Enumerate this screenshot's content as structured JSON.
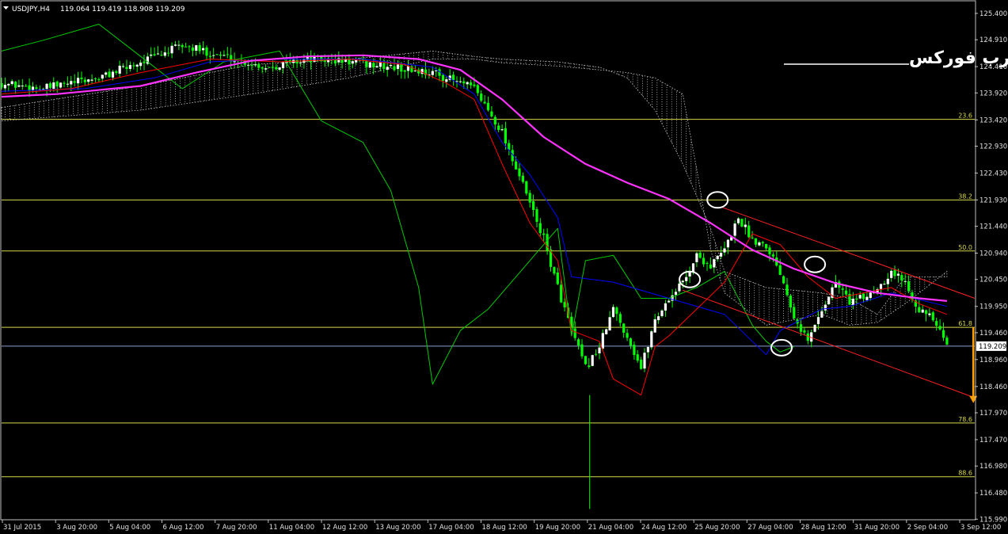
{
  "header": {
    "symbol": "USDJPY,H4",
    "ohlc": "119.064 119.419 118.908 119.209"
  },
  "brand": {
    "text": "عرب فوركس",
    "color": "#ffffff"
  },
  "colors": {
    "background": "#000000",
    "frame": "#c0c0c0",
    "bull_candle": "#ffffff",
    "bear_candle": "#00ff00",
    "ma_slow": "#ff33ff",
    "tenkan": "#ff0000",
    "kijun": "#0000ff",
    "chikou": "#00cc00",
    "cloud": "#c8c8c8",
    "fib_line": "#d8d84a",
    "bid_line": "#8ea0d0",
    "trend_line": "#ff2020",
    "arrow": "#ffa000",
    "annotation": "#ffffff"
  },
  "chart_data": {
    "type": "candlestick",
    "symbol": "USDJPY",
    "timeframe": "H4",
    "y_range": [
      115.98,
      125.62
    ],
    "y_ticks": [
      "125.400",
      "124.910",
      "124.410",
      "123.920",
      "123.420",
      "122.930",
      "122.430",
      "121.930",
      "121.440",
      "120.940",
      "120.450",
      "119.950",
      "119.460",
      "118.960",
      "118.460",
      "117.970",
      "117.470",
      "116.980",
      "116.480",
      "115.990"
    ],
    "x_ticks": [
      "31 Jul 2015",
      "3 Aug 20:00",
      "5 Aug 04:00",
      "6 Aug 12:00",
      "7 Aug 20:00",
      "11 Aug 04:00",
      "12 Aug 12:00",
      "13 Aug 20:00",
      "17 Aug 04:00",
      "18 Aug 12:00",
      "19 Aug 20:00",
      "21 Aug 04:00",
      "24 Aug 12:00",
      "25 Aug 20:00",
      "27 Aug 04:00",
      "28 Aug 12:00",
      "31 Aug 20:00",
      "2 Sep 04:00",
      "3 Sep 12:00"
    ],
    "current_price": "119.209",
    "fibonacci_levels": [
      {
        "label": "23.6",
        "price": 123.43
      },
      {
        "label": "38.2",
        "price": 121.93
      },
      {
        "label": "50.0",
        "price": 120.98
      },
      {
        "label": "61.8",
        "price": 119.56
      },
      {
        "label": "78.6",
        "price": 117.78
      },
      {
        "label": "88.6",
        "price": 116.78
      }
    ],
    "price_path": [
      [
        0,
        124.1
      ],
      [
        6,
        124.0
      ],
      [
        14,
        124.2
      ],
      [
        20,
        124.5
      ],
      [
        26,
        124.8
      ],
      [
        32,
        124.6
      ],
      [
        38,
        124.4
      ],
      [
        44,
        124.55
      ],
      [
        50,
        124.5
      ],
      [
        56,
        124.4
      ],
      [
        62,
        124.3
      ],
      [
        68,
        124.0
      ],
      [
        72,
        123.2
      ],
      [
        75,
        122.2
      ],
      [
        78,
        121.2
      ],
      [
        80,
        120.3
      ],
      [
        82,
        119.5
      ],
      [
        84,
        118.8
      ],
      [
        86,
        119.2
      ],
      [
        88,
        119.9
      ],
      [
        90,
        119.4
      ],
      [
        92,
        118.8
      ],
      [
        94,
        119.7
      ],
      [
        96,
        120.1
      ],
      [
        98,
        120.4
      ],
      [
        100,
        120.9
      ],
      [
        102,
        120.7
      ],
      [
        104,
        121.0
      ],
      [
        106,
        121.6
      ],
      [
        108,
        121.2
      ],
      [
        110,
        121.1
      ],
      [
        112,
        120.6
      ],
      [
        114,
        119.8
      ],
      [
        116,
        119.3
      ],
      [
        118,
        119.9
      ],
      [
        120,
        120.4
      ],
      [
        122,
        120.05
      ],
      [
        124,
        120.1
      ],
      [
        126,
        120.3
      ],
      [
        128,
        120.6
      ],
      [
        130,
        120.4
      ],
      [
        132,
        119.9
      ],
      [
        134,
        119.7
      ],
      [
        136,
        119.2
      ]
    ],
    "ma_slow": [
      [
        0,
        123.85
      ],
      [
        8,
        123.9
      ],
      [
        20,
        124.05
      ],
      [
        28,
        124.3
      ],
      [
        36,
        124.52
      ],
      [
        44,
        124.6
      ],
      [
        52,
        124.62
      ],
      [
        60,
        124.55
      ],
      [
        66,
        124.35
      ],
      [
        72,
        123.8
      ],
      [
        78,
        123.1
      ],
      [
        84,
        122.6
      ],
      [
        90,
        122.25
      ],
      [
        96,
        121.95
      ],
      [
        102,
        121.5
      ],
      [
        108,
        121.0
      ],
      [
        114,
        120.65
      ],
      [
        120,
        120.38
      ],
      [
        126,
        120.2
      ],
      [
        132,
        120.1
      ],
      [
        136,
        120.05
      ]
    ],
    "tenkan": [
      [
        0,
        123.9
      ],
      [
        10,
        124.0
      ],
      [
        20,
        124.3
      ],
      [
        30,
        124.55
      ],
      [
        40,
        124.5
      ],
      [
        50,
        124.55
      ],
      [
        58,
        124.45
      ],
      [
        64,
        124.1
      ],
      [
        68,
        123.8
      ],
      [
        72,
        122.6
      ],
      [
        76,
        121.5
      ],
      [
        80,
        120.8
      ],
      [
        82,
        119.5
      ],
      [
        86,
        119.3
      ],
      [
        88,
        118.6
      ],
      [
        92,
        118.3
      ],
      [
        94,
        119.2
      ],
      [
        96,
        119.4
      ],
      [
        100,
        119.9
      ],
      [
        104,
        120.4
      ],
      [
        108,
        121.3
      ],
      [
        112,
        121.1
      ],
      [
        116,
        120.5
      ],
      [
        120,
        120.1
      ],
      [
        124,
        120.2
      ],
      [
        128,
        120.3
      ],
      [
        132,
        120.0
      ],
      [
        136,
        119.8
      ]
    ],
    "kijun": [
      [
        0,
        123.95
      ],
      [
        12,
        124.0
      ],
      [
        22,
        124.2
      ],
      [
        30,
        124.5
      ],
      [
        40,
        124.55
      ],
      [
        52,
        124.55
      ],
      [
        62,
        124.4
      ],
      [
        68,
        123.9
      ],
      [
        72,
        123.0
      ],
      [
        76,
        122.4
      ],
      [
        80,
        121.6
      ],
      [
        82,
        120.5
      ],
      [
        88,
        120.4
      ],
      [
        96,
        120.1
      ],
      [
        104,
        119.8
      ],
      [
        108,
        119.3
      ],
      [
        110,
        119.05
      ],
      [
        112,
        119.5
      ],
      [
        118,
        119.9
      ],
      [
        122,
        119.95
      ],
      [
        128,
        120.2
      ],
      [
        136,
        119.95
      ]
    ],
    "chikou": [
      [
        0,
        124.7
      ],
      [
        6,
        124.9
      ],
      [
        14,
        125.2
      ],
      [
        20,
        124.6
      ],
      [
        26,
        124.0
      ],
      [
        32,
        124.5
      ],
      [
        40,
        124.7
      ],
      [
        46,
        123.4
      ],
      [
        52,
        123.0
      ],
      [
        56,
        122.1
      ],
      [
        60,
        120.3
      ],
      [
        62,
        118.5
      ],
      [
        66,
        119.5
      ],
      [
        70,
        119.9
      ],
      [
        74,
        120.5
      ],
      [
        78,
        121.1
      ],
      [
        80,
        121.4
      ],
      [
        82,
        119.4
      ],
      [
        84,
        120.8
      ],
      [
        88,
        120.9
      ],
      [
        92,
        120.1
      ],
      [
        96,
        120.1
      ],
      [
        100,
        120.3
      ],
      [
        104,
        120.6
      ],
      [
        108,
        119.6
      ],
      [
        110,
        119.3
      ],
      [
        112,
        119.1
      ],
      [
        114,
        119.2
      ]
    ],
    "cloud_a": [
      [
        0,
        123.65
      ],
      [
        20,
        124.05
      ],
      [
        36,
        124.45
      ],
      [
        50,
        124.55
      ],
      [
        62,
        124.7
      ],
      [
        68,
        124.6
      ],
      [
        72,
        124.55
      ],
      [
        80,
        124.5
      ],
      [
        86,
        124.4
      ],
      [
        90,
        124.2
      ],
      [
        94,
        123.6
      ],
      [
        98,
        122.6
      ],
      [
        100,
        122.0
      ],
      [
        102,
        121.4
      ],
      [
        104,
        120.6
      ],
      [
        110,
        120.3
      ],
      [
        118,
        120.2
      ],
      [
        122,
        120.1
      ],
      [
        126,
        119.8
      ],
      [
        130,
        120.5
      ],
      [
        136,
        120.5
      ]
    ],
    "cloud_b": [
      [
        0,
        123.4
      ],
      [
        20,
        123.6
      ],
      [
        36,
        123.9
      ],
      [
        50,
        124.2
      ],
      [
        62,
        124.55
      ],
      [
        68,
        124.55
      ],
      [
        72,
        124.48
      ],
      [
        80,
        124.42
      ],
      [
        86,
        124.35
      ],
      [
        90,
        124.3
      ],
      [
        94,
        124.2
      ],
      [
        98,
        123.9
      ],
      [
        100,
        122.5
      ],
      [
        102,
        121.0
      ],
      [
        104,
        120.2
      ],
      [
        110,
        119.6
      ],
      [
        118,
        119.8
      ],
      [
        122,
        119.6
      ],
      [
        126,
        119.65
      ],
      [
        130,
        120.0
      ],
      [
        136,
        120.6
      ]
    ],
    "trend_upper": {
      "from": [
        103.5,
        121.8
      ],
      "to": [
        140.0,
        120.1
      ]
    },
    "trend_lower": {
      "from": [
        98.0,
        120.25
      ],
      "to": [
        140.0,
        118.25
      ]
    },
    "circles": [
      [
        103.0,
        121.93
      ],
      [
        99.0,
        120.45
      ],
      [
        117.0,
        120.73
      ],
      [
        112.2,
        119.18
      ]
    ],
    "arrow": {
      "from": [
        139.8,
        119.56
      ],
      "to": [
        139.8,
        118.15
      ]
    }
  }
}
